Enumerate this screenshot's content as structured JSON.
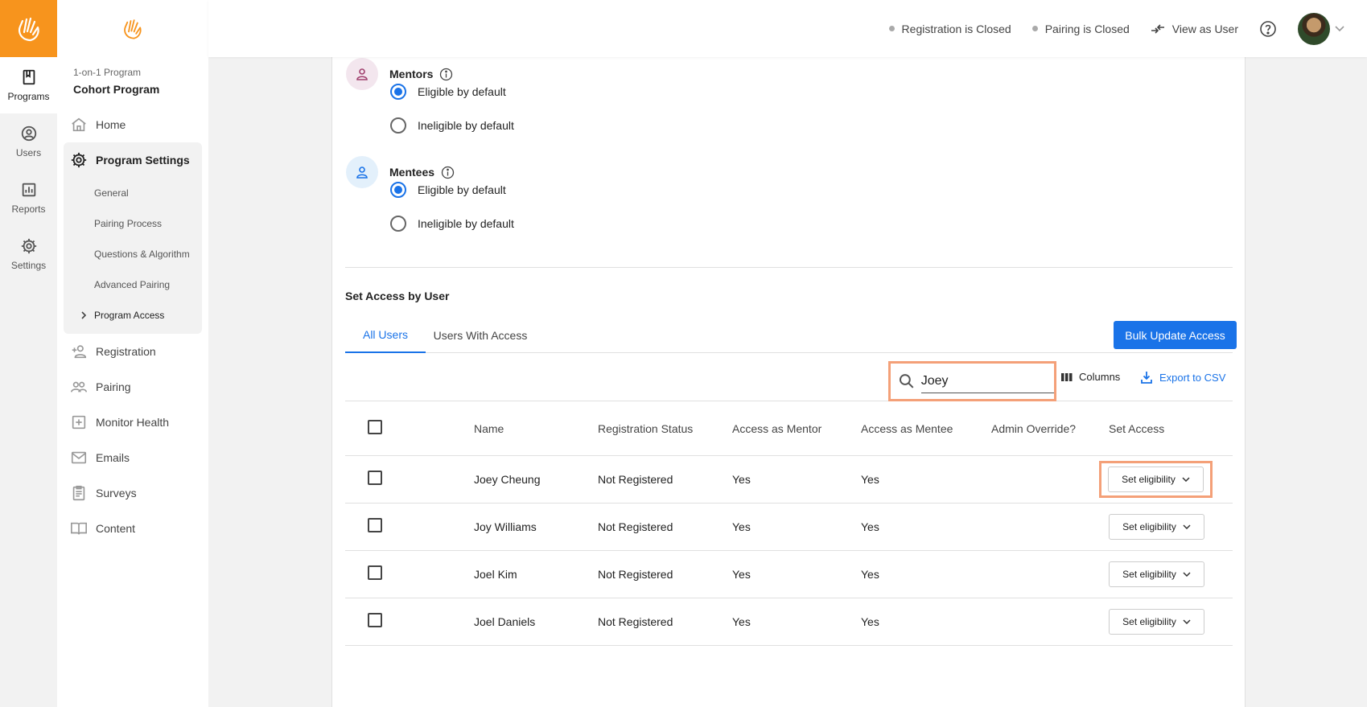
{
  "rail": {
    "items": [
      {
        "label": "Programs",
        "icon": "book-icon"
      },
      {
        "label": "Users",
        "icon": "user-circle-icon"
      },
      {
        "label": "Reports",
        "icon": "bar-chart-icon"
      },
      {
        "label": "Settings",
        "icon": "gear-icon"
      }
    ]
  },
  "sidebar": {
    "program_type": "1-on-1 Program",
    "program_name": "Cohort Program",
    "home": "Home",
    "program_settings": "Program Settings",
    "settings_sub": [
      "General",
      "Pairing Process",
      "Questions & Algorithm",
      "Advanced Pairing",
      "Program Access"
    ],
    "items_after": [
      "Registration",
      "Pairing",
      "Monitor Health",
      "Emails",
      "Surveys",
      "Content"
    ]
  },
  "topbar": {
    "registration_status": "Registration is Closed",
    "pairing_status": "Pairing is Closed",
    "view_as_user": "View as User"
  },
  "roles": {
    "mentors": {
      "title": "Mentors",
      "option1": "Eligible by default",
      "option2": "Ineligible by default",
      "selected": "option1"
    },
    "mentees": {
      "title": "Mentees",
      "option1": "Eligible by default",
      "option2": "Ineligible by default",
      "selected": "option1"
    }
  },
  "access": {
    "section_title": "Set Access by User",
    "tabs": [
      "All Users",
      "Users With Access"
    ],
    "bulk_button": "Bulk Update Access",
    "search_value": "Joey",
    "columns_label": "Columns",
    "export_label": "Export to CSV",
    "headers": [
      "Name",
      "Registration Status",
      "Access as Mentor",
      "Access as Mentee",
      "Admin Override?",
      "Set Access"
    ],
    "set_eligibility_label": "Set eligibility",
    "rows": [
      {
        "name": "Joey Cheung",
        "status": "Not Registered",
        "mentor": "Yes",
        "mentee": "Yes",
        "override": ""
      },
      {
        "name": "Joy Williams",
        "status": "Not Registered",
        "mentor": "Yes",
        "mentee": "Yes",
        "override": ""
      },
      {
        "name": "Joel Kim",
        "status": "Not Registered",
        "mentor": "Yes",
        "mentee": "Yes",
        "override": ""
      },
      {
        "name": "Joel Daniels",
        "status": "Not Registered",
        "mentor": "Yes",
        "mentee": "Yes",
        "override": ""
      }
    ]
  },
  "colors": {
    "brand": "#f7941d",
    "accent": "#1a73e8",
    "highlight": "#f4a078"
  }
}
